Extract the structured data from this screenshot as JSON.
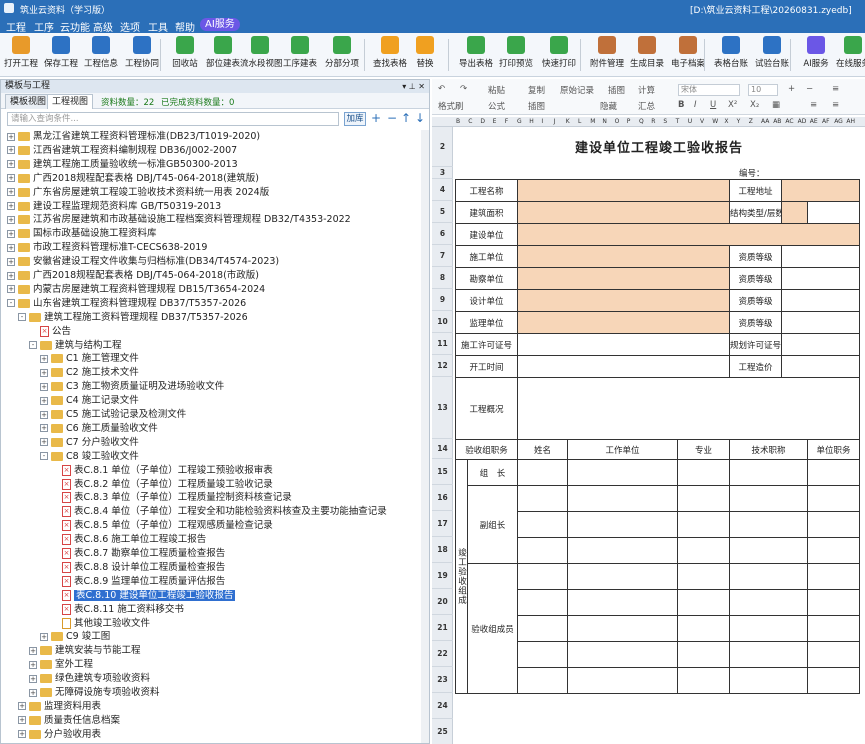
{
  "titlebar": {
    "app": "筑业云资料（学习版）",
    "path": "[D:\\筑业云资料工程\\20260831.zyedb]"
  },
  "menu": [
    "工程",
    "工序",
    "云功能",
    "高级",
    "选项",
    "工具",
    "帮助",
    "AI服务"
  ],
  "toolbar": [
    {
      "label": "打开工程",
      "icon": "open-project-icon",
      "color": "#e89a2a"
    },
    {
      "label": "保存工程",
      "icon": "save-icon",
      "color": "#2d72c4"
    },
    {
      "label": "工程信息",
      "icon": "project-info-icon",
      "color": "#2d72c4"
    },
    {
      "label": "工程协同",
      "icon": "collaborate-icon",
      "color": "#2d72c4"
    },
    {
      "label": "回收站",
      "icon": "recycle-bin-icon",
      "color": "#3aa64b"
    },
    {
      "label": "部位建表",
      "icon": "position-table-icon",
      "color": "#3aa64b"
    },
    {
      "label": "流水段视图",
      "icon": "flow-section-icon",
      "color": "#3aa64b"
    },
    {
      "label": "工序建表",
      "icon": "process-table-icon",
      "color": "#3aa64b"
    },
    {
      "label": "分部分项",
      "icon": "subitem-icon",
      "color": "#3aa64b"
    },
    {
      "label": "查找表格",
      "icon": "find-table-icon",
      "color": "#f0a020"
    },
    {
      "label": "替换",
      "icon": "replace-icon",
      "color": "#f0a020"
    },
    {
      "label": "导出表格",
      "icon": "export-table-icon",
      "color": "#3aa64b"
    },
    {
      "label": "打印预览",
      "icon": "print-preview-icon",
      "color": "#3aa64b"
    },
    {
      "label": "快速打印",
      "icon": "quick-print-icon",
      "color": "#3aa64b"
    },
    {
      "label": "附件管理",
      "icon": "attachment-icon",
      "color": "#c0703a"
    },
    {
      "label": "生成目录",
      "icon": "catalog-icon",
      "color": "#c0703a"
    },
    {
      "label": "电子档案",
      "icon": "e-archive-icon",
      "color": "#c0703a"
    },
    {
      "label": "表格台账",
      "icon": "ledger-icon",
      "color": "#2d72c4"
    },
    {
      "label": "试验台账",
      "icon": "test-ledger-icon",
      "color": "#2d72c4"
    },
    {
      "label": "AI服务",
      "icon": "ai-service-icon",
      "color": "#6b57e6"
    },
    {
      "label": "在线服务",
      "icon": "online-service-icon",
      "color": "#3aa64b"
    }
  ],
  "left": {
    "panel_title": "模板与工程",
    "tabs": [
      "模板视图",
      "工程视图"
    ],
    "count_label": "资料数量：22",
    "done_label": "已完成资料数量：0",
    "search_placeholder": "请输入查询条件...",
    "search_btn": "加库"
  },
  "tree": [
    {
      "lvl": 0,
      "t": "f",
      "exp": "+",
      "label": "黑龙江省建筑工程资料管理标准(DB23/T1019-2020)"
    },
    {
      "lvl": 0,
      "t": "f",
      "exp": "+",
      "label": "江西省建筑工程资料编制规程 DB36/J002-2007"
    },
    {
      "lvl": 0,
      "t": "f",
      "exp": "+",
      "label": "建筑工程施工质量验收统一标准GB50300-2013"
    },
    {
      "lvl": 0,
      "t": "f",
      "exp": "+",
      "label": "广西2018规程配套表格 DBJ/T45-064-2018(建筑版)"
    },
    {
      "lvl": 0,
      "t": "f",
      "exp": "+",
      "label": "广东省房屋建筑工程竣工验收技术资料统一用表 2024版"
    },
    {
      "lvl": 0,
      "t": "f",
      "exp": "+",
      "label": "建设工程监理规范资料库 GB/T50319-2013"
    },
    {
      "lvl": 0,
      "t": "f",
      "exp": "+",
      "label": "江苏省房屋建筑和市政基础设施工程档案资料管理规程 DB32/T4353-2022"
    },
    {
      "lvl": 0,
      "t": "f",
      "exp": "+",
      "label": "国标市政基础设施工程资料库"
    },
    {
      "lvl": 0,
      "t": "f",
      "exp": "+",
      "label": "市政工程资料管理标准T-CECS638-2019"
    },
    {
      "lvl": 0,
      "t": "f",
      "exp": "+",
      "label": "安徽省建设工程文件收集与归档标准(DB34/T4574-2023)"
    },
    {
      "lvl": 0,
      "t": "f",
      "exp": "+",
      "label": "广西2018规程配套表格 DBJ/T45-064-2018(市政版)"
    },
    {
      "lvl": 0,
      "t": "f",
      "exp": "+",
      "label": "内蒙古房屋建筑工程资料管理规程 DB15/T3654-2024"
    },
    {
      "lvl": 0,
      "t": "f",
      "exp": "-",
      "label": "山东省建筑工程资料管理规程 DB37/T5357-2026"
    },
    {
      "lvl": 1,
      "t": "f",
      "exp": "-",
      "label": "建筑工程施工资料管理规程 DB37/T5357-2026"
    },
    {
      "lvl": 2,
      "t": "d",
      "exp": "",
      "label": "公告"
    },
    {
      "lvl": 2,
      "t": "f",
      "exp": "-",
      "label": "建筑与结构工程"
    },
    {
      "lvl": 3,
      "t": "f",
      "exp": "+",
      "label": "C1 施工管理文件"
    },
    {
      "lvl": 3,
      "t": "f",
      "exp": "+",
      "label": "C2 施工技术文件"
    },
    {
      "lvl": 3,
      "t": "f",
      "exp": "+",
      "label": "C3 施工物资质量证明及进场验收文件"
    },
    {
      "lvl": 3,
      "t": "f",
      "exp": "+",
      "label": "C4 施工记录文件"
    },
    {
      "lvl": 3,
      "t": "f",
      "exp": "+",
      "label": "C5 施工试验记录及检测文件"
    },
    {
      "lvl": 3,
      "t": "f",
      "exp": "+",
      "label": "C6 施工质量验收文件"
    },
    {
      "lvl": 3,
      "t": "f",
      "exp": "+",
      "label": "C7 分户验收文件"
    },
    {
      "lvl": 3,
      "t": "f",
      "exp": "-",
      "label": "C8 竣工验收文件"
    },
    {
      "lvl": 4,
      "t": "d",
      "exp": "",
      "label": "表C.8.1 单位（子单位）工程竣工预验收报审表"
    },
    {
      "lvl": 4,
      "t": "d",
      "exp": "",
      "label": "表C.8.2 单位（子单位）工程质量竣工验收记录"
    },
    {
      "lvl": 4,
      "t": "d",
      "exp": "",
      "label": "表C.8.3 单位（子单位）工程质量控制资料核查记录"
    },
    {
      "lvl": 4,
      "t": "d",
      "exp": "",
      "label": "表C.8.4 单位（子单位）工程安全和功能检验资料核查及主要功能抽查记录"
    },
    {
      "lvl": 4,
      "t": "d",
      "exp": "",
      "label": "表C.8.5 单位（子单位）工程观感质量检查记录"
    },
    {
      "lvl": 4,
      "t": "d",
      "exp": "",
      "label": "表C.8.6 施工单位工程竣工报告"
    },
    {
      "lvl": 4,
      "t": "d",
      "exp": "",
      "label": "表C.8.7 勘察单位工程质量检查报告"
    },
    {
      "lvl": 4,
      "t": "d",
      "exp": "",
      "label": "表C.8.8 设计单位工程质量检查报告"
    },
    {
      "lvl": 4,
      "t": "d",
      "exp": "",
      "label": "表C.8.9 监理单位工程质量评估报告"
    },
    {
      "lvl": 4,
      "t": "d",
      "exp": "",
      "label": "表C.8.10 建设单位工程竣工验收报告",
      "sel": true
    },
    {
      "lvl": 4,
      "t": "d",
      "exp": "",
      "label": "表C.8.11 施工资料移交书"
    },
    {
      "lvl": 4,
      "t": "o",
      "exp": "",
      "label": "其他竣工验收文件"
    },
    {
      "lvl": 3,
      "t": "f",
      "exp": "+",
      "label": "C9 竣工图"
    },
    {
      "lvl": 2,
      "t": "f",
      "exp": "+",
      "label": "建筑安装与节能工程"
    },
    {
      "lvl": 2,
      "t": "f",
      "exp": "+",
      "label": "室外工程"
    },
    {
      "lvl": 2,
      "t": "f",
      "exp": "+",
      "label": "绿色建筑专项验收资料"
    },
    {
      "lvl": 2,
      "t": "f",
      "exp": "+",
      "label": "无障碍设施专项验收资料"
    },
    {
      "lvl": 1,
      "t": "f",
      "exp": "+",
      "label": "监理资料用表"
    },
    {
      "lvl": 1,
      "t": "f",
      "exp": "+",
      "label": "质量责任信息档案"
    },
    {
      "lvl": 1,
      "t": "f",
      "exp": "+",
      "label": "分户验收用表"
    }
  ],
  "fmt": {
    "row1": [
      "粘贴",
      "复制",
      "剪切",
      "原始记录",
      "插图",
      "计算",
      "字体"
    ],
    "row2": [
      "格式刷",
      "公式",
      "插图",
      "插表",
      "隐藏",
      "汇总"
    ],
    "font": "宋体",
    "size": "10"
  },
  "columns": [
    "B",
    "C",
    "D",
    "E",
    "F",
    "G",
    "H",
    "I",
    "J",
    "K",
    "L",
    "M",
    "N",
    "O",
    "P",
    "Q",
    "R",
    "S",
    "T",
    "U",
    "V",
    "W",
    "X",
    "Y",
    "Z",
    "AA",
    "AB",
    "AC",
    "AD",
    "AE",
    "AF",
    "AG",
    "AH"
  ],
  "sheet": {
    "title": "建设单位工程竣工验收报告",
    "no_label": "编号：",
    "rows": {
      "r4": {
        "a": "工程名称",
        "b": "工程地址"
      },
      "r5": {
        "a": "建筑面积",
        "b": "结构类型/层数"
      },
      "r6": {
        "a": "建设单位"
      },
      "r7": {
        "a": "施工单位",
        "b": "资质等级"
      },
      "r8": {
        "a": "勘察单位",
        "b": "资质等级"
      },
      "r9": {
        "a": "设计单位",
        "b": "资质等级"
      },
      "r10": {
        "a": "监理单位",
        "b": "资质等级"
      },
      "r11": {
        "a": "施工许可证号",
        "b": "规划许可证号"
      },
      "r12": {
        "a": "开工时间",
        "b": "工程造价"
      },
      "r13": {
        "a": "工程概况"
      },
      "r14": {
        "h1": "验收组职务",
        "h2": "姓名",
        "h3": "工作单位",
        "h4": "专业",
        "h5": "技术职称",
        "h6": "单位职务"
      },
      "leader": "组　长",
      "deputy": "副组长",
      "group": "竣工验收组成",
      "member": "验收组成员"
    },
    "row_numbers": [
      "2",
      "3",
      "4",
      "5",
      "6",
      "7",
      "8",
      "9",
      "10",
      "11",
      "12",
      "13",
      "14",
      "15",
      "16",
      "17",
      "18",
      "19",
      "20",
      "21",
      "22",
      "23",
      "24",
      "25"
    ]
  }
}
